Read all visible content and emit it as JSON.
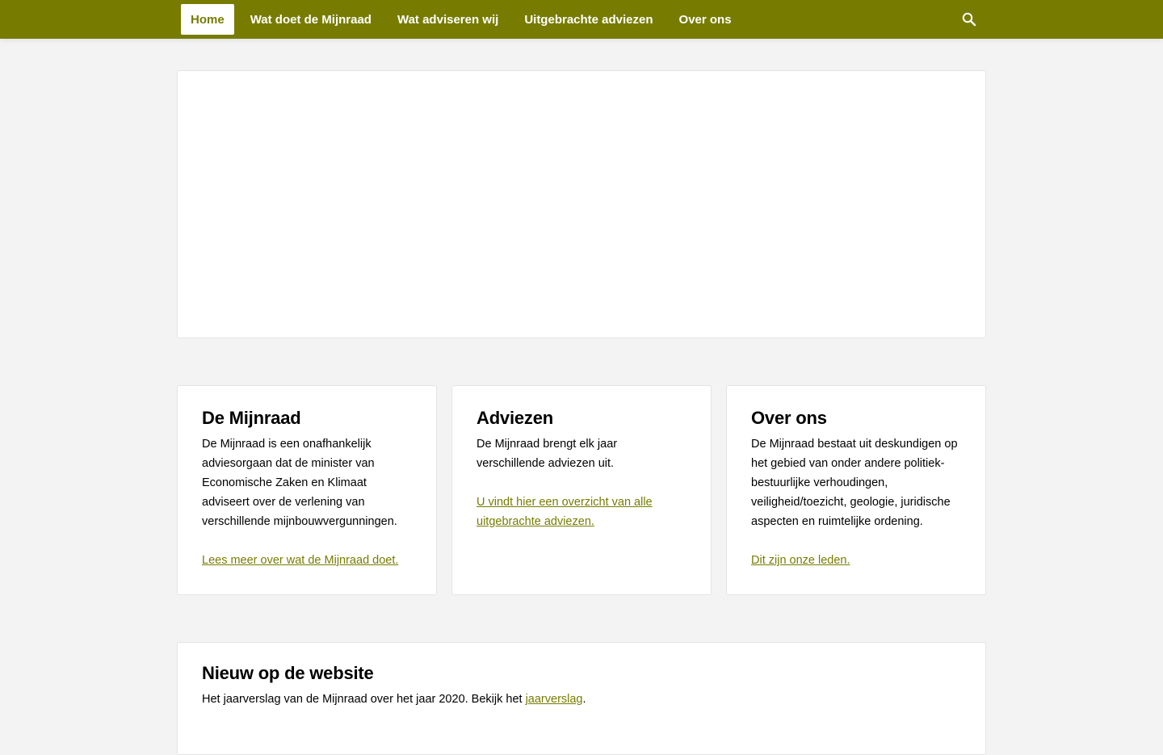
{
  "nav": {
    "items": [
      {
        "label": "Home",
        "active": true
      },
      {
        "label": "Wat doet de Mijnraad",
        "active": false
      },
      {
        "label": "Wat adviseren wij",
        "active": false
      },
      {
        "label": "Uitgebrachte adviezen",
        "active": false
      },
      {
        "label": "Over ons",
        "active": false
      }
    ],
    "search_icon": "search-icon"
  },
  "colors": {
    "brand": "#777c00",
    "page_background": "#f3f3f3",
    "card_background": "#ffffff"
  },
  "cards": [
    {
      "title": "De Mijnraad",
      "body": "De Mijnraad is een onafhankelijk adviesorgaan dat de minister van Economische Zaken en Klimaat adviseert over de verlening van verschillende mijnbouwvergunningen.",
      "link": "Lees meer over wat de Mijnraad doet."
    },
    {
      "title": "Adviezen",
      "body": "De Mijnraad brengt elk jaar verschillende adviezen uit.",
      "link": "U vindt hier een overzicht van alle uitgebrachte adviezen."
    },
    {
      "title": "Over ons",
      "body": "De Mijnraad bestaat uit deskundigen op het gebied van onder andere politiek-bestuurlijke verhoudingen, veiligheid/toezicht, geologie, juridische aspecten en ruimtelijke ordening.",
      "link": "Dit zijn onze leden."
    }
  ],
  "news": {
    "title": "Nieuw op de website",
    "text_before": "Het jaarverslag van de Mijnraad over het jaar 2020. Bekijk het ",
    "link": "jaarverslag",
    "text_after": "."
  }
}
